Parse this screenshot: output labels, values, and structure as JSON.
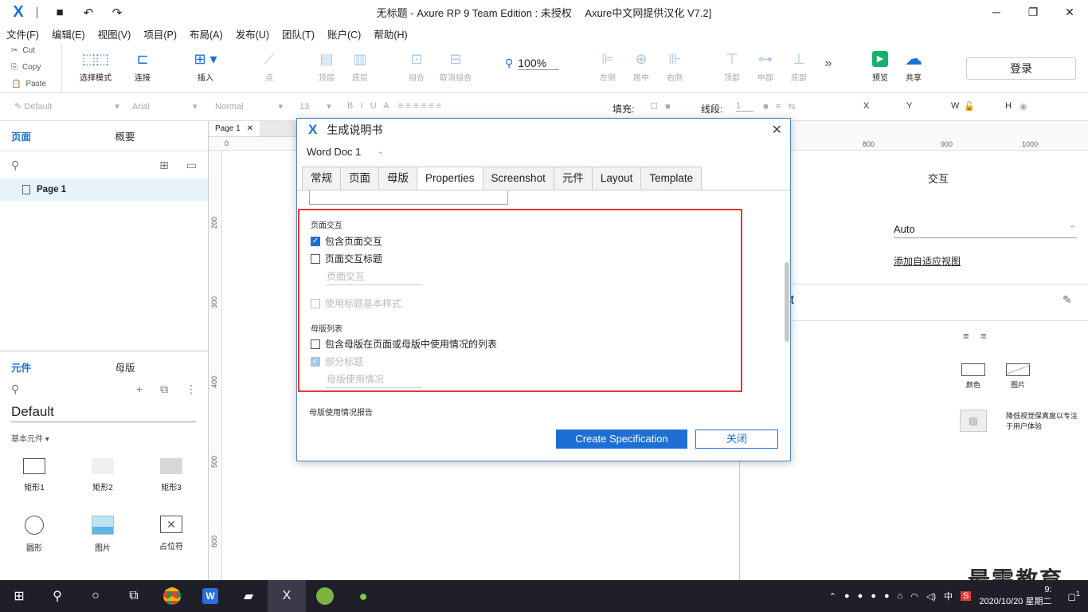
{
  "window": {
    "title": "无标题 - Axure RP 9 Team Edition : 未授权　 Axure中文网提供汉化 V7.2]",
    "controls": [
      "─",
      "❐",
      "✕"
    ]
  },
  "menu": [
    "文件(F)",
    "编辑(E)",
    "视图(V)",
    "项目(P)",
    "布局(A)",
    "发布(U)",
    "团队(T)",
    "账户(C)",
    "帮助(H)"
  ],
  "clipboard": {
    "cut": "Cut",
    "copy": "Copy",
    "paste": "Paste"
  },
  "toolbar": {
    "select_mode": "选择模式",
    "connect": "连接",
    "insert": "插入",
    "point": "点",
    "top_layer": "顶层",
    "bottom_layer": "底层",
    "group": "组合",
    "ungroup": "取消组合",
    "zoom": "100%",
    "align_left": "左侧",
    "align_center": "居中",
    "align_right": "右侧",
    "align_top": "顶部",
    "align_middle": "中部",
    "align_bottom": "底部",
    "preview": "预览",
    "share": "共享",
    "login": "登录"
  },
  "stylebar": {
    "style": "Default",
    "font": "Arial",
    "weight": "Normal",
    "size": "13",
    "fill_label": "填充:",
    "stroke_label": "线段:",
    "stroke_value": "1",
    "x": "X",
    "y": "Y",
    "w": "W",
    "h": "H"
  },
  "pages_panel": {
    "tab_pages": "页面",
    "tab_outline": "概要",
    "page_name": "Page 1"
  },
  "library_panel": {
    "tab_widgets": "元件",
    "tab_masters": "母版",
    "library": "Default",
    "category": "基本元件 ▾",
    "widgets": [
      "矩形1",
      "矩形2",
      "矩形3",
      "圆形",
      "图片",
      "占位符"
    ]
  },
  "canvas": {
    "tab": "Page 1",
    "ruler_h": [
      "0",
      "800",
      "900",
      "1000"
    ],
    "ruler_v": [
      "200",
      "300",
      "400",
      "500",
      "600"
    ]
  },
  "right_panel": {
    "tab_interaction": "交互",
    "adaptive_value": "Auto",
    "add_adaptive": "添加自适应视图",
    "partial_title": "lt",
    "fill_color": "颜色",
    "fill_image": "图片",
    "low_fidelity": "降低视觉保真度以专注于用户体验"
  },
  "dialog": {
    "title": "生成说明书",
    "format": "Word Doc 1",
    "tabs": [
      "常规",
      "页面",
      "母版",
      "Properties",
      "Screenshot",
      "元件",
      "Layout",
      "Template"
    ],
    "active_tab": "Properties",
    "section_page_interactions": "页面交互",
    "include_page_interactions": "包含页面交互",
    "page_interaction_title": "页面交互标题",
    "page_interaction_title_value": "页面交互",
    "use_heading_style": "使用标题基本样式",
    "section_masters_list": "母版列表",
    "include_masters_list": "包含母版在页面或母版中使用情况的列表",
    "partial_heading": "部分标题",
    "masters_usage_value": "母版使用情况",
    "section_masters_usage_report": "母版使用情况报告",
    "create_button": "Create Specification",
    "close_button": "关闭"
  },
  "taskbar": {
    "ime": "中",
    "time": "9:",
    "date": "2020/10/20 星期二",
    "notification_count": "1"
  },
  "watermark": "最需教育",
  "colors": {
    "accent": "#1d6fd6",
    "highlight": "#e53935"
  }
}
